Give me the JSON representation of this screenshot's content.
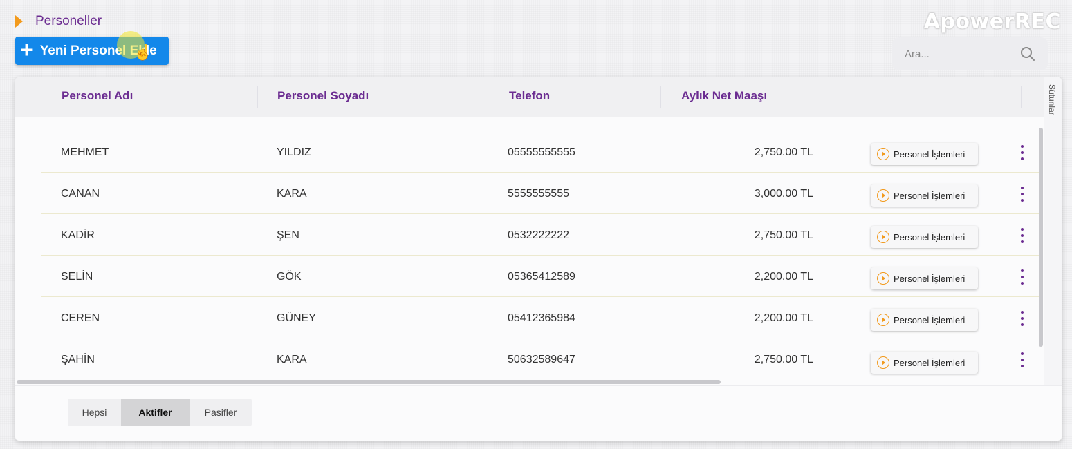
{
  "breadcrumb": {
    "title": "Personeller"
  },
  "watermark": "ApowerREC",
  "toolbar": {
    "add_label": "Yeni Personel Ekle"
  },
  "search": {
    "placeholder": "Ara..."
  },
  "table": {
    "columns": [
      "Personel Adı",
      "Personel Soyadı",
      "Telefon",
      "Aylık Net Maaşı"
    ],
    "side_panel_label": "Sütunlar",
    "action_label": "Personel İşlemleri",
    "rows": [
      {
        "first_name": "MEHMET",
        "last_name": "YILDIZ",
        "phone": "05555555555",
        "salary": "2,750.00 TL"
      },
      {
        "first_name": "CANAN",
        "last_name": "KARA",
        "phone": "5555555555",
        "salary": "3,000.00 TL"
      },
      {
        "first_name": "KADİR",
        "last_name": "ŞEN",
        "phone": "0532222222",
        "salary": "2,750.00 TL"
      },
      {
        "first_name": "SELİN",
        "last_name": "GÖK",
        "phone": "05365412589",
        "salary": "2,200.00 TL"
      },
      {
        "first_name": "CEREN",
        "last_name": "GÜNEY",
        "phone": "05412365984",
        "salary": "2,200.00 TL"
      },
      {
        "first_name": "ŞAHİN",
        "last_name": "KARA",
        "phone": "50632589647",
        "salary": "2,750.00 TL"
      }
    ]
  },
  "filters": {
    "all": "Hepsi",
    "active": "Aktifler",
    "passive": "Pasifler",
    "selected": "Aktifler"
  },
  "colors": {
    "accent_purple": "#6b2c91",
    "primary_blue": "#1388ea",
    "orange": "#f29a1d"
  }
}
